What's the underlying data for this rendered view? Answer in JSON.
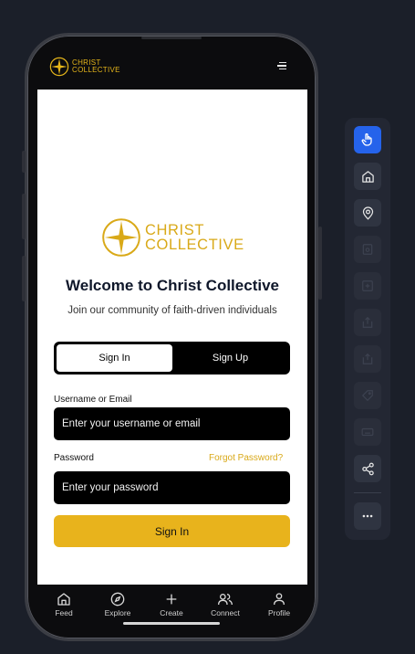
{
  "app": {
    "brand_line1": "CHRIST",
    "brand_line2": "COLLECTIVE",
    "accent_color": "#e5b51a"
  },
  "header": {
    "menu_icon": "hamburger-icon"
  },
  "welcome": {
    "title": "Welcome to Christ Collective",
    "subtitle": "Join our community of faith-driven individuals"
  },
  "tabs": [
    {
      "label": "Sign In",
      "active": true
    },
    {
      "label": "Sign Up",
      "active": false
    }
  ],
  "form": {
    "username_label": "Username or Email",
    "username_placeholder": "Enter your username or email",
    "password_label": "Password",
    "forgot_label": "Forgot Password?",
    "password_placeholder": "Enter your password",
    "submit_label": "Sign In"
  },
  "bottom_nav": [
    {
      "label": "Feed",
      "icon": "home-icon"
    },
    {
      "label": "Explore",
      "icon": "compass-icon"
    },
    {
      "label": "Create",
      "icon": "plus-icon"
    },
    {
      "label": "Connect",
      "icon": "users-icon"
    },
    {
      "label": "Profile",
      "icon": "user-icon"
    }
  ],
  "toolbar": {
    "tools": [
      {
        "icon": "pointer-hand-icon",
        "state": "active"
      },
      {
        "icon": "home-icon",
        "state": "enabled"
      },
      {
        "icon": "location-pin-icon",
        "state": "enabled"
      },
      {
        "icon": "screenshot-icon",
        "state": "disabled"
      },
      {
        "icon": "expand-icon",
        "state": "disabled"
      },
      {
        "icon": "upload-icon",
        "state": "disabled"
      },
      {
        "icon": "share-square-icon",
        "state": "disabled"
      },
      {
        "icon": "tag-icon",
        "state": "disabled"
      },
      {
        "icon": "keyboard-icon",
        "state": "disabled"
      },
      {
        "icon": "share-icon",
        "state": "enabled"
      },
      {
        "icon": "more-icon",
        "state": "enabled"
      }
    ],
    "active_color": "#2563eb"
  }
}
